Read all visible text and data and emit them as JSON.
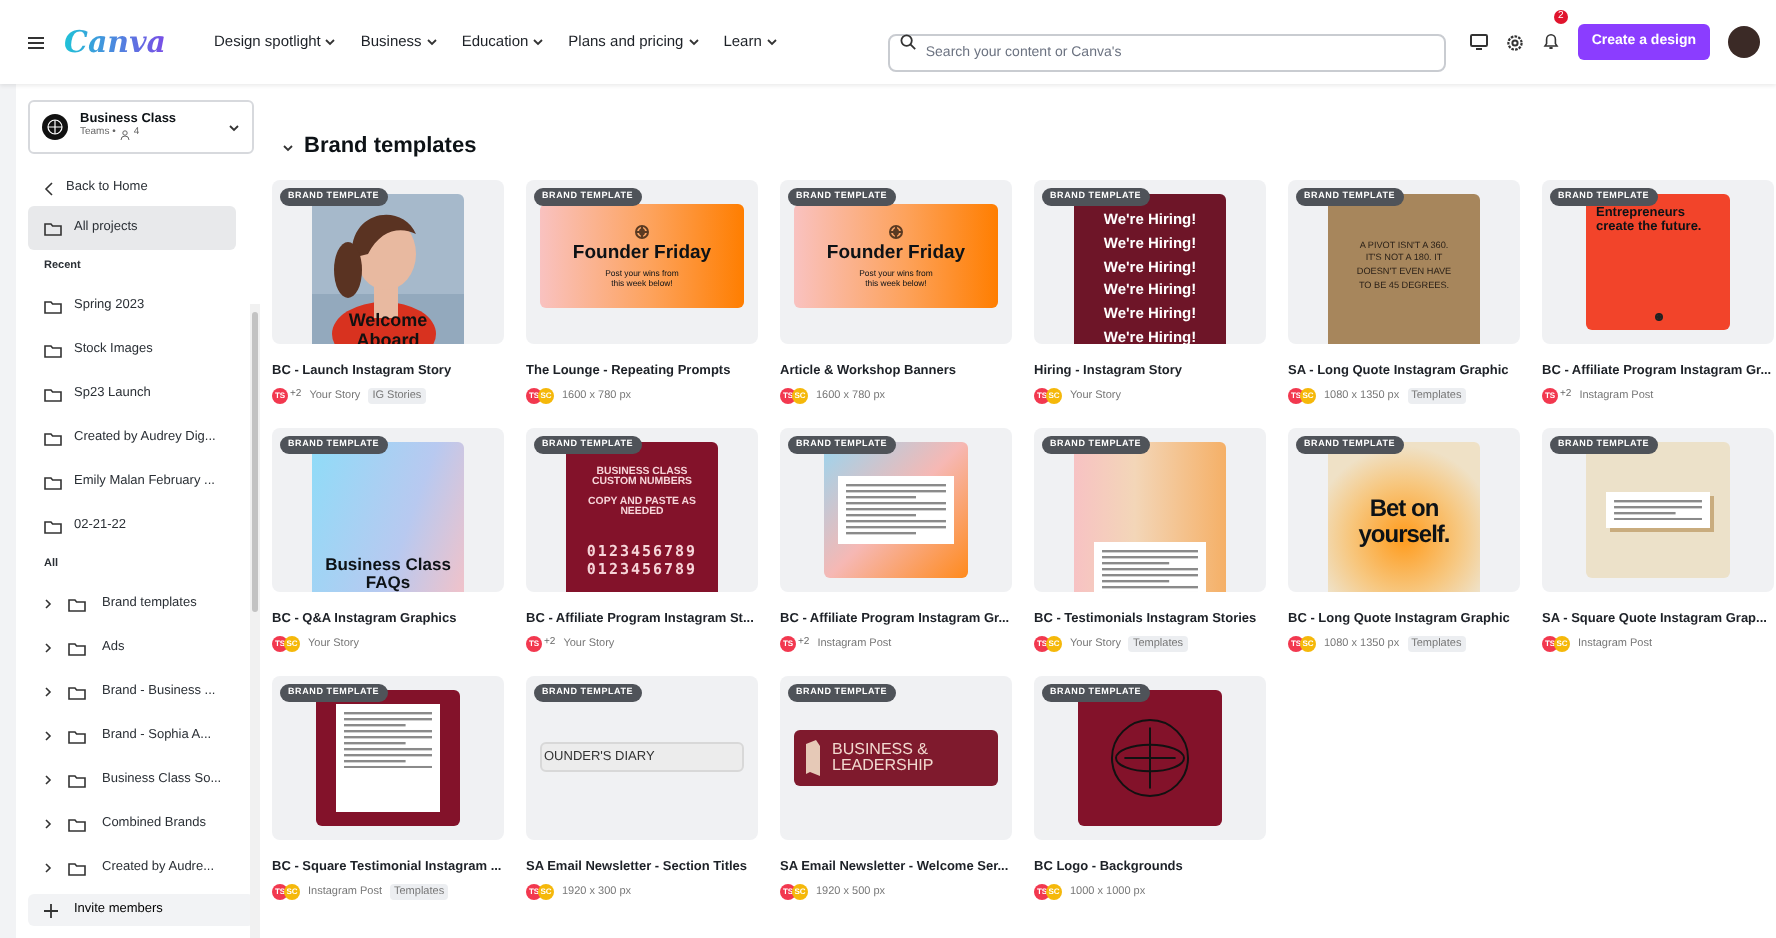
{
  "header": {
    "logo": "Canva",
    "menu": [
      {
        "label": "Design spotlight"
      },
      {
        "label": "Business"
      },
      {
        "label": "Education"
      },
      {
        "label": "Plans and pricing"
      },
      {
        "label": "Learn"
      }
    ],
    "search": {
      "placeholder": "Search your content or Canva's"
    },
    "notifications": "2",
    "create_button": "Create a design"
  },
  "sidebar": {
    "team": {
      "name": "Business Class",
      "plan": "Teams •",
      "members": "4"
    },
    "back": "Back to Home",
    "projects": [
      {
        "label": "All projects",
        "selected": true
      }
    ],
    "recent": {
      "heading": "Recent",
      "items": [
        {
          "label": "Spring 2023",
          "selected": false
        },
        {
          "label": "Stock Images",
          "selected": false
        },
        {
          "label": "Sp23 Launch",
          "selected": false
        },
        {
          "label": "Created by Audrey Dig...",
          "selected": false
        },
        {
          "label": "Emily Malan February ...",
          "selected": false
        },
        {
          "label": "02-21-22",
          "selected": false
        }
      ]
    },
    "all": {
      "heading": "All",
      "items": [
        {
          "label": "Brand templates",
          "expanded": false
        },
        {
          "label": "Ads",
          "expanded": false
        },
        {
          "label": "Brand - Business ...",
          "expanded": false
        },
        {
          "label": "Brand - Sophia A...",
          "expanded": false
        },
        {
          "label": "Business Class So...",
          "expanded": false
        },
        {
          "label": "Combined Brands",
          "expanded": false
        },
        {
          "label": "Created by Audre...",
          "expanded": false
        }
      ]
    },
    "invite": "Invite members"
  },
  "section": {
    "title": "Brand templates",
    "expanded": true
  },
  "cards": [
    {
      "badge": "BRAND TEMPLATE",
      "thumb": {
        "texts": [
          "Welcome Aboard"
        ]
      },
      "title": "BC - Launch Instagram Story",
      "avatars": [
        {
          "kind": "user",
          "text": "TS",
          "color": "#f2384f"
        },
        {
          "kind": "more",
          "text": "+2"
        }
      ],
      "info": "Your Story",
      "tag": "IG Stories"
    },
    {
      "badge": "BRAND TEMPLATE",
      "thumb": {
        "kind": "banner",
        "texts": [
          "Founder Friday",
          "Post your wins from this week below!"
        ]
      },
      "title": "The Lounge - Repeating Prompts",
      "avatars": [
        {
          "kind": "user",
          "text": "TS",
          "color": "#f2384f"
        },
        {
          "kind": "user",
          "text": "SC",
          "color": "#f5b80a"
        }
      ],
      "info": "1600 x 780 px"
    },
    {
      "badge": "BRAND TEMPLATE",
      "thumb": {
        "kind": "banner",
        "texts": [
          "Founder Friday",
          "Post your wins from this week below!"
        ]
      },
      "title": "Article & Workshop Banners",
      "avatars": [
        {
          "kind": "user",
          "text": "TS",
          "color": "#f2384f"
        },
        {
          "kind": "user",
          "text": "SC",
          "color": "#f5b80a"
        }
      ],
      "info": "1600 x 780 px"
    },
    {
      "badge": "BRAND TEMPLATE",
      "thumb": {
        "kind": "hiring",
        "texts": [
          "We're Hiring!",
          "We're Hiring!",
          "We're Hiring!",
          "We're Hiring!",
          "We're Hiring!",
          "We're Hiring!"
        ]
      },
      "title": "Hiring - Instagram Story",
      "avatars": [
        {
          "kind": "user",
          "text": "TS",
          "color": "#f2384f"
        },
        {
          "kind": "user",
          "text": "SC",
          "color": "#f5b80a"
        }
      ],
      "info": "Your Story"
    },
    {
      "badge": "BRAND TEMPLATE",
      "thumb": {
        "kind": "quote",
        "texts": [
          "A PIVOT ISN'T A 360. IT'S NOT A 180. IT DOESN'T EVEN HAVE TO BE 45 DEGREES."
        ]
      },
      "title": "SA - Long Quote Instagram Graphic",
      "avatars": [
        {
          "kind": "user",
          "text": "TS",
          "color": "#f2384f"
        },
        {
          "kind": "user",
          "text": "SC",
          "color": "#f5b80a"
        }
      ],
      "info": "1080 x 1350 px",
      "tag": "Templates"
    },
    {
      "badge": "BRAND TEMPLATE",
      "thumb": {
        "kind": "red",
        "texts": [
          "Entrepreneurs create the future."
        ]
      },
      "title": "BC - Affiliate Program Instagram Gr...",
      "avatars": [
        {
          "kind": "user",
          "text": "TS",
          "color": "#f2384f"
        },
        {
          "kind": "more",
          "text": "+2"
        }
      ],
      "info": "Instagram Post"
    },
    {
      "badge": "BRAND TEMPLATE",
      "thumb": {
        "kind": "faq",
        "texts": [
          "Business Class FAQs"
        ]
      },
      "title": "BC - Q&A Instagram Graphics",
      "avatars": [
        {
          "kind": "user",
          "text": "TS",
          "color": "#f2384f"
        },
        {
          "kind": "user",
          "text": "SC",
          "color": "#f5b80a"
        }
      ],
      "info": "Your Story"
    },
    {
      "badge": "BRAND TEMPLATE",
      "thumb": {
        "kind": "numbers",
        "texts": [
          "BUSINESS CLASS CUSTOM NUMBERS",
          "COPY AND PASTE AS NEEDED",
          "0123456789",
          "0123456789"
        ]
      },
      "title": "BC - Affiliate Program Instagram St...",
      "avatars": [
        {
          "kind": "user",
          "text": "TS",
          "color": "#f2384f"
        },
        {
          "kind": "more",
          "text": "+2"
        }
      ],
      "info": "Your Story"
    },
    {
      "badge": "BRAND TEMPLATE",
      "thumb": {
        "kind": "gradient-card"
      },
      "title": "BC - Affiliate Program Instagram Gr...",
      "avatars": [
        {
          "kind": "user",
          "text": "TS",
          "color": "#f2384f"
        },
        {
          "kind": "more",
          "text": "+2"
        }
      ],
      "info": "Instagram Post"
    },
    {
      "badge": "BRAND TEMPLATE",
      "thumb": {
        "kind": "story-card"
      },
      "title": "BC - Testimonials Instagram Stories",
      "avatars": [
        {
          "kind": "user",
          "text": "TS",
          "color": "#f2384f"
        },
        {
          "kind": "user",
          "text": "SC",
          "color": "#f5b80a"
        }
      ],
      "info": "Your Story",
      "tag": "Templates"
    },
    {
      "badge": "BRAND TEMPLATE",
      "thumb": {
        "kind": "bet",
        "texts": [
          "Bet on yourself."
        ]
      },
      "title": "BC - Long Quote Instagram Graphic",
      "avatars": [
        {
          "kind": "user",
          "text": "TS",
          "color": "#f2384f"
        },
        {
          "kind": "user",
          "text": "SC",
          "color": "#f5b80a"
        }
      ],
      "info": "1080 x 1350 px",
      "tag": "Templates"
    },
    {
      "badge": "BRAND TEMPLATE",
      "thumb": {
        "kind": "square-quote"
      },
      "title": "SA - Square Quote Instagram Grap...",
      "avatars": [
        {
          "kind": "user",
          "text": "TS",
          "color": "#f2384f"
        },
        {
          "kind": "user",
          "text": "SC",
          "color": "#f5b80a"
        }
      ],
      "info": "Instagram Post"
    },
    {
      "badge": "BRAND TEMPLATE",
      "thumb": {
        "kind": "frame"
      },
      "title": "BC - Square Testimonial Instagram ...",
      "avatars": [
        {
          "kind": "user",
          "text": "TS",
          "color": "#f2384f"
        },
        {
          "kind": "user",
          "text": "SC",
          "color": "#f5b80a"
        }
      ],
      "info": "Instagram Post",
      "tag": "Templates"
    },
    {
      "badge": "BRAND TEMPLATE",
      "thumb": {
        "kind": "title-bar",
        "texts": [
          "OUNDER'S DIARY"
        ]
      },
      "title": "SA Email Newsletter - Section Titles",
      "avatars": [
        {
          "kind": "user",
          "text": "TS",
          "color": "#f2384f"
        },
        {
          "kind": "user",
          "text": "SC",
          "color": "#f5b80a"
        }
      ],
      "info": "1920 x 300 px"
    },
    {
      "badge": "BRAND TEMPLATE",
      "thumb": {
        "kind": "welcome",
        "texts": [
          "BUSINESS & LEADERSHIP"
        ]
      },
      "title": "SA Email Newsletter - Welcome Ser...",
      "avatars": [
        {
          "kind": "user",
          "text": "TS",
          "color": "#f2384f"
        },
        {
          "kind": "user",
          "text": "SC",
          "color": "#f5b80a"
        }
      ],
      "info": "1920 x 500 px"
    },
    {
      "badge": "BRAND TEMPLATE",
      "thumb": {
        "kind": "logo"
      },
      "title": "BC Logo - Backgrounds",
      "avatars": [
        {
          "kind": "user",
          "text": "TS",
          "color": "#f2384f"
        },
        {
          "kind": "user",
          "text": "SC",
          "color": "#f5b80a"
        }
      ],
      "info": "1000 x 1000 px"
    }
  ]
}
